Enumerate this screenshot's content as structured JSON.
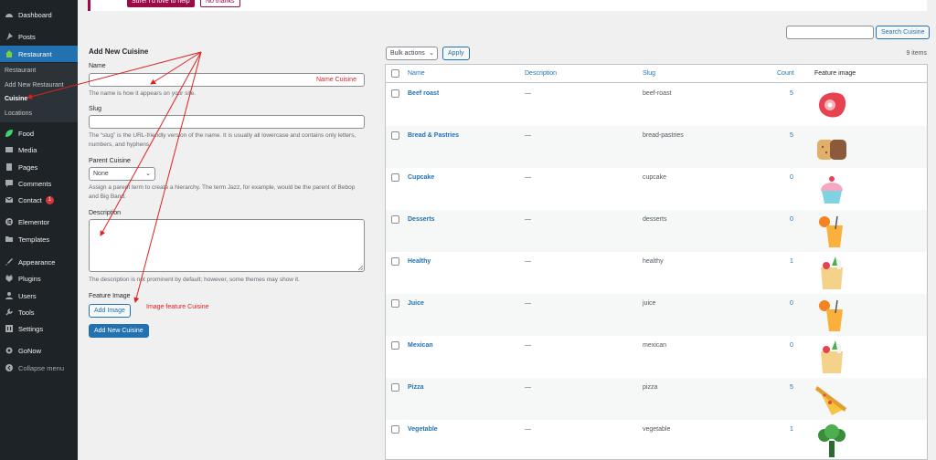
{
  "sidebar": {
    "items": [
      {
        "label": "Dashboard",
        "icon": "dashboard-icon"
      },
      {
        "label": "Posts",
        "icon": "pin-icon"
      },
      {
        "label": "Restaurant",
        "icon": "home-icon"
      },
      {
        "label": "Food",
        "icon": "leaf-icon"
      },
      {
        "label": "Media",
        "icon": "media-icon"
      },
      {
        "label": "Pages",
        "icon": "page-icon"
      },
      {
        "label": "Comments",
        "icon": "comment-icon"
      },
      {
        "label": "Contact",
        "icon": "mail-icon",
        "badge": "1"
      },
      {
        "label": "Elementor",
        "icon": "elementor-icon"
      },
      {
        "label": "Templates",
        "icon": "folder-icon"
      },
      {
        "label": "Appearance",
        "icon": "brush-icon"
      },
      {
        "label": "Plugins",
        "icon": "plugin-icon"
      },
      {
        "label": "Users",
        "icon": "user-icon"
      },
      {
        "label": "Tools",
        "icon": "wrench-icon"
      },
      {
        "label": "Settings",
        "icon": "settings-icon"
      },
      {
        "label": "GoNow",
        "icon": "gear-icon"
      },
      {
        "label": "Collapse menu",
        "icon": "collapse-icon"
      }
    ],
    "submenu": [
      "Restaurant",
      "Add New Restaurant",
      "Cuisine",
      "Locations"
    ]
  },
  "notice": {
    "primary": "Sure! I'd love to help",
    "secondary": "No thanks"
  },
  "form": {
    "heading": "Add New Cuisine",
    "name_label": "Name",
    "name_help": "The name is how it appears on your site.",
    "slug_label": "Slug",
    "slug_help": "The “slug” is the URL-friendly version of the name. It is usually all lowercase and contains only letters, numbers, and hyphens.",
    "parent_label": "Parent Cuisine",
    "parent_value": "None",
    "parent_help": "Assign a parent term to create a hierarchy. The term Jazz, for example, would be the parent of Bebop and Big Band.",
    "description_label": "Description",
    "description_help": "The description is not prominent by default; however, some themes may show it.",
    "feature_label": "Feature Image",
    "add_image": "Add Image",
    "submit": "Add New Cuisine"
  },
  "annotations": {
    "name": "Name Cuisine",
    "image": "Image feature Cuisine",
    "color": "#e02020"
  },
  "list": {
    "search_button": "Search Cuisine",
    "bulk_actions": "Bulk actions",
    "apply": "Apply",
    "items_count": "9 items",
    "columns": [
      "Name",
      "Description",
      "Slug",
      "Count",
      "Feature image"
    ],
    "rows": [
      {
        "name": "Beef roast",
        "description": "—",
        "slug": "beef-roast",
        "count": "5",
        "image": "beef-icon"
      },
      {
        "name": "Bread & Pastries",
        "description": "—",
        "slug": "bread-pastries",
        "count": "5",
        "image": "bread-icon"
      },
      {
        "name": "Cupcake",
        "description": "—",
        "slug": "cupcake",
        "count": "0",
        "image": "cupcake-icon"
      },
      {
        "name": "Desserts",
        "description": "—",
        "slug": "desserts",
        "count": "0",
        "image": "juice-icon"
      },
      {
        "name": "Healthy",
        "description": "—",
        "slug": "healthy",
        "count": "1",
        "image": "grocery-bag-icon"
      },
      {
        "name": "Juice",
        "description": "—",
        "slug": "juice",
        "count": "0",
        "image": "juice-icon"
      },
      {
        "name": "Mexican",
        "description": "—",
        "slug": "mexican",
        "count": "0",
        "image": "grocery-bag-icon"
      },
      {
        "name": "Pizza",
        "description": "—",
        "slug": "pizza",
        "count": "5",
        "image": "pizza-icon"
      },
      {
        "name": "Vegetable",
        "description": "—",
        "slug": "vegetable",
        "count": "1",
        "image": "broccoli-icon"
      }
    ]
  },
  "colors": {
    "accent": "#2271b1",
    "sidebar": "#1d2327",
    "active": "#2271b1",
    "brand": "#9d0a4a"
  }
}
